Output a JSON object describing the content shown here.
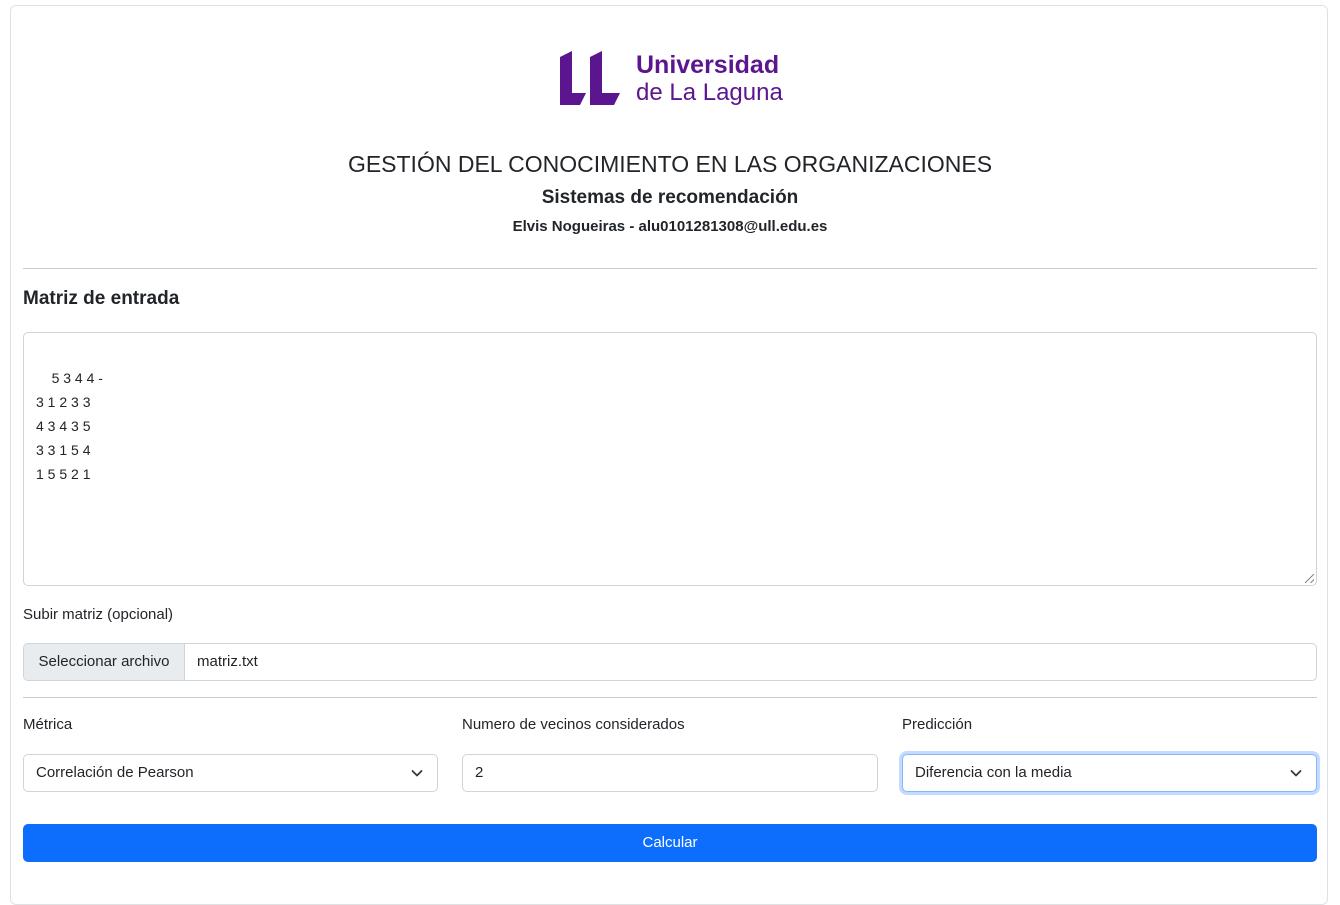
{
  "logo": {
    "line1": "Universidad",
    "line2": "de La Laguna",
    "color": "#5b168f"
  },
  "header": {
    "title": "GESTIÓN DEL CONOCIMIENTO EN LAS ORGANIZACIONES",
    "subtitle": "Sistemas de recomendación",
    "author": "Elvis Nogueiras - alu0101281308@ull.edu.es"
  },
  "matrix_section": {
    "title": "Matriz de entrada",
    "value": "5 3 4 4 -\n3 1 2 3 3\n4 3 4 3 5\n3 3 1 5 4\n1 5 5 2 1"
  },
  "upload": {
    "label": "Subir matriz (opcional)",
    "button_label": "Seleccionar archivo",
    "file_name": "matriz.txt"
  },
  "metric": {
    "label": "Métrica",
    "selected": "Correlación de Pearson",
    "icon": "chevron-down-icon"
  },
  "neighbors": {
    "label": "Numero de vecinos considerados",
    "value": "2"
  },
  "prediction": {
    "label": "Predicción",
    "selected": "Diferencia con la media",
    "icon": "chevron-down-icon"
  },
  "submit": {
    "label": "Calcular",
    "color": "#0d6efd"
  }
}
